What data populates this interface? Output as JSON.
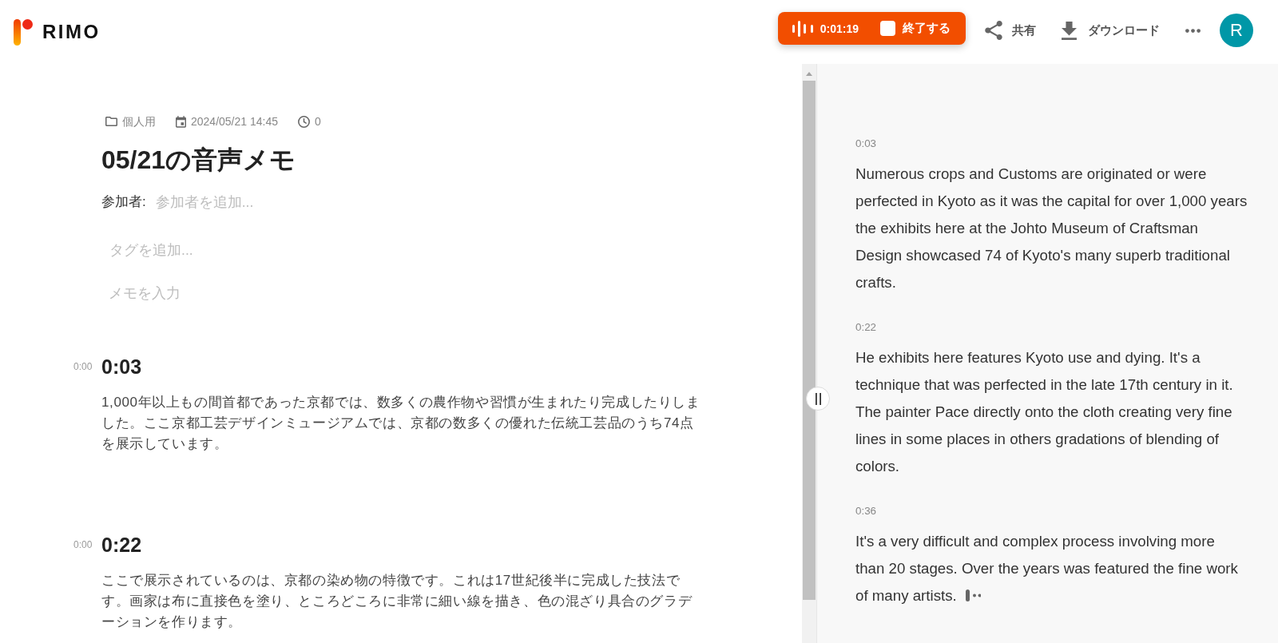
{
  "header": {
    "logo": "RIMO",
    "recording": {
      "elapsed": "0:01:19",
      "stop_label": "終了する"
    },
    "actions": [
      {
        "kind": "share",
        "label": "共有"
      },
      {
        "kind": "download",
        "label": "ダウンロード"
      },
      {
        "kind": "more"
      }
    ],
    "avatar": "R"
  },
  "note": {
    "meta": [
      {
        "kind": "folder",
        "text": "個人用"
      },
      {
        "kind": "calendar",
        "text": "2024/05/21 14:45"
      },
      {
        "kind": "clock",
        "text": "0"
      }
    ],
    "title": "05/21の音声メモ",
    "participants": {
      "label": "参加者:",
      "placeholder": "参加者を追加..."
    },
    "tags": {
      "placeholder": "タグを追加..."
    },
    "memo": {
      "placeholder": "メモを入力"
    },
    "segments": [
      {
        "offset": "0:00",
        "time": "0:03",
        "text": "1,000年以上もの間首都であった京都では、数多くの農作物や習慣が生まれたり完成したりしました。ここ京都工芸デザインミュージアムでは、京都の数多くの優れた伝統工芸品のうち74点を展示しています。"
      },
      {
        "offset": "0:00",
        "time": "0:22",
        "text": "ここで展示されているのは、京都の染め物の特徴です。これは17世紀後半に完成した技法です。画家は布に直接色を塗り、ところどころに非常に細い線を描き、色の混ざり具合のグラデーションを作ります。"
      }
    ]
  },
  "transcript": {
    "segments": [
      {
        "time": "0:03",
        "text": "Numerous crops and Customs are originated or were perfected in Kyoto as it was the capital for over 1,000 years the exhibits here at the Johto Museum of Craftsman Design showcased 74 of Kyoto's many superb traditional crafts.",
        "typing": false
      },
      {
        "time": "0:22",
        "text": "He exhibits here features Kyoto use and dying. It's a technique that was perfected in the late 17th century in it. The painter Pace directly onto the cloth creating very fine lines in some places in others gradations of blending of colors.",
        "typing": false
      },
      {
        "time": "0:36",
        "text": "It's a very difficult and complex process involving more than 20 stages. Over the years was featured the fine work of many artists.",
        "typing": true
      }
    ]
  }
}
